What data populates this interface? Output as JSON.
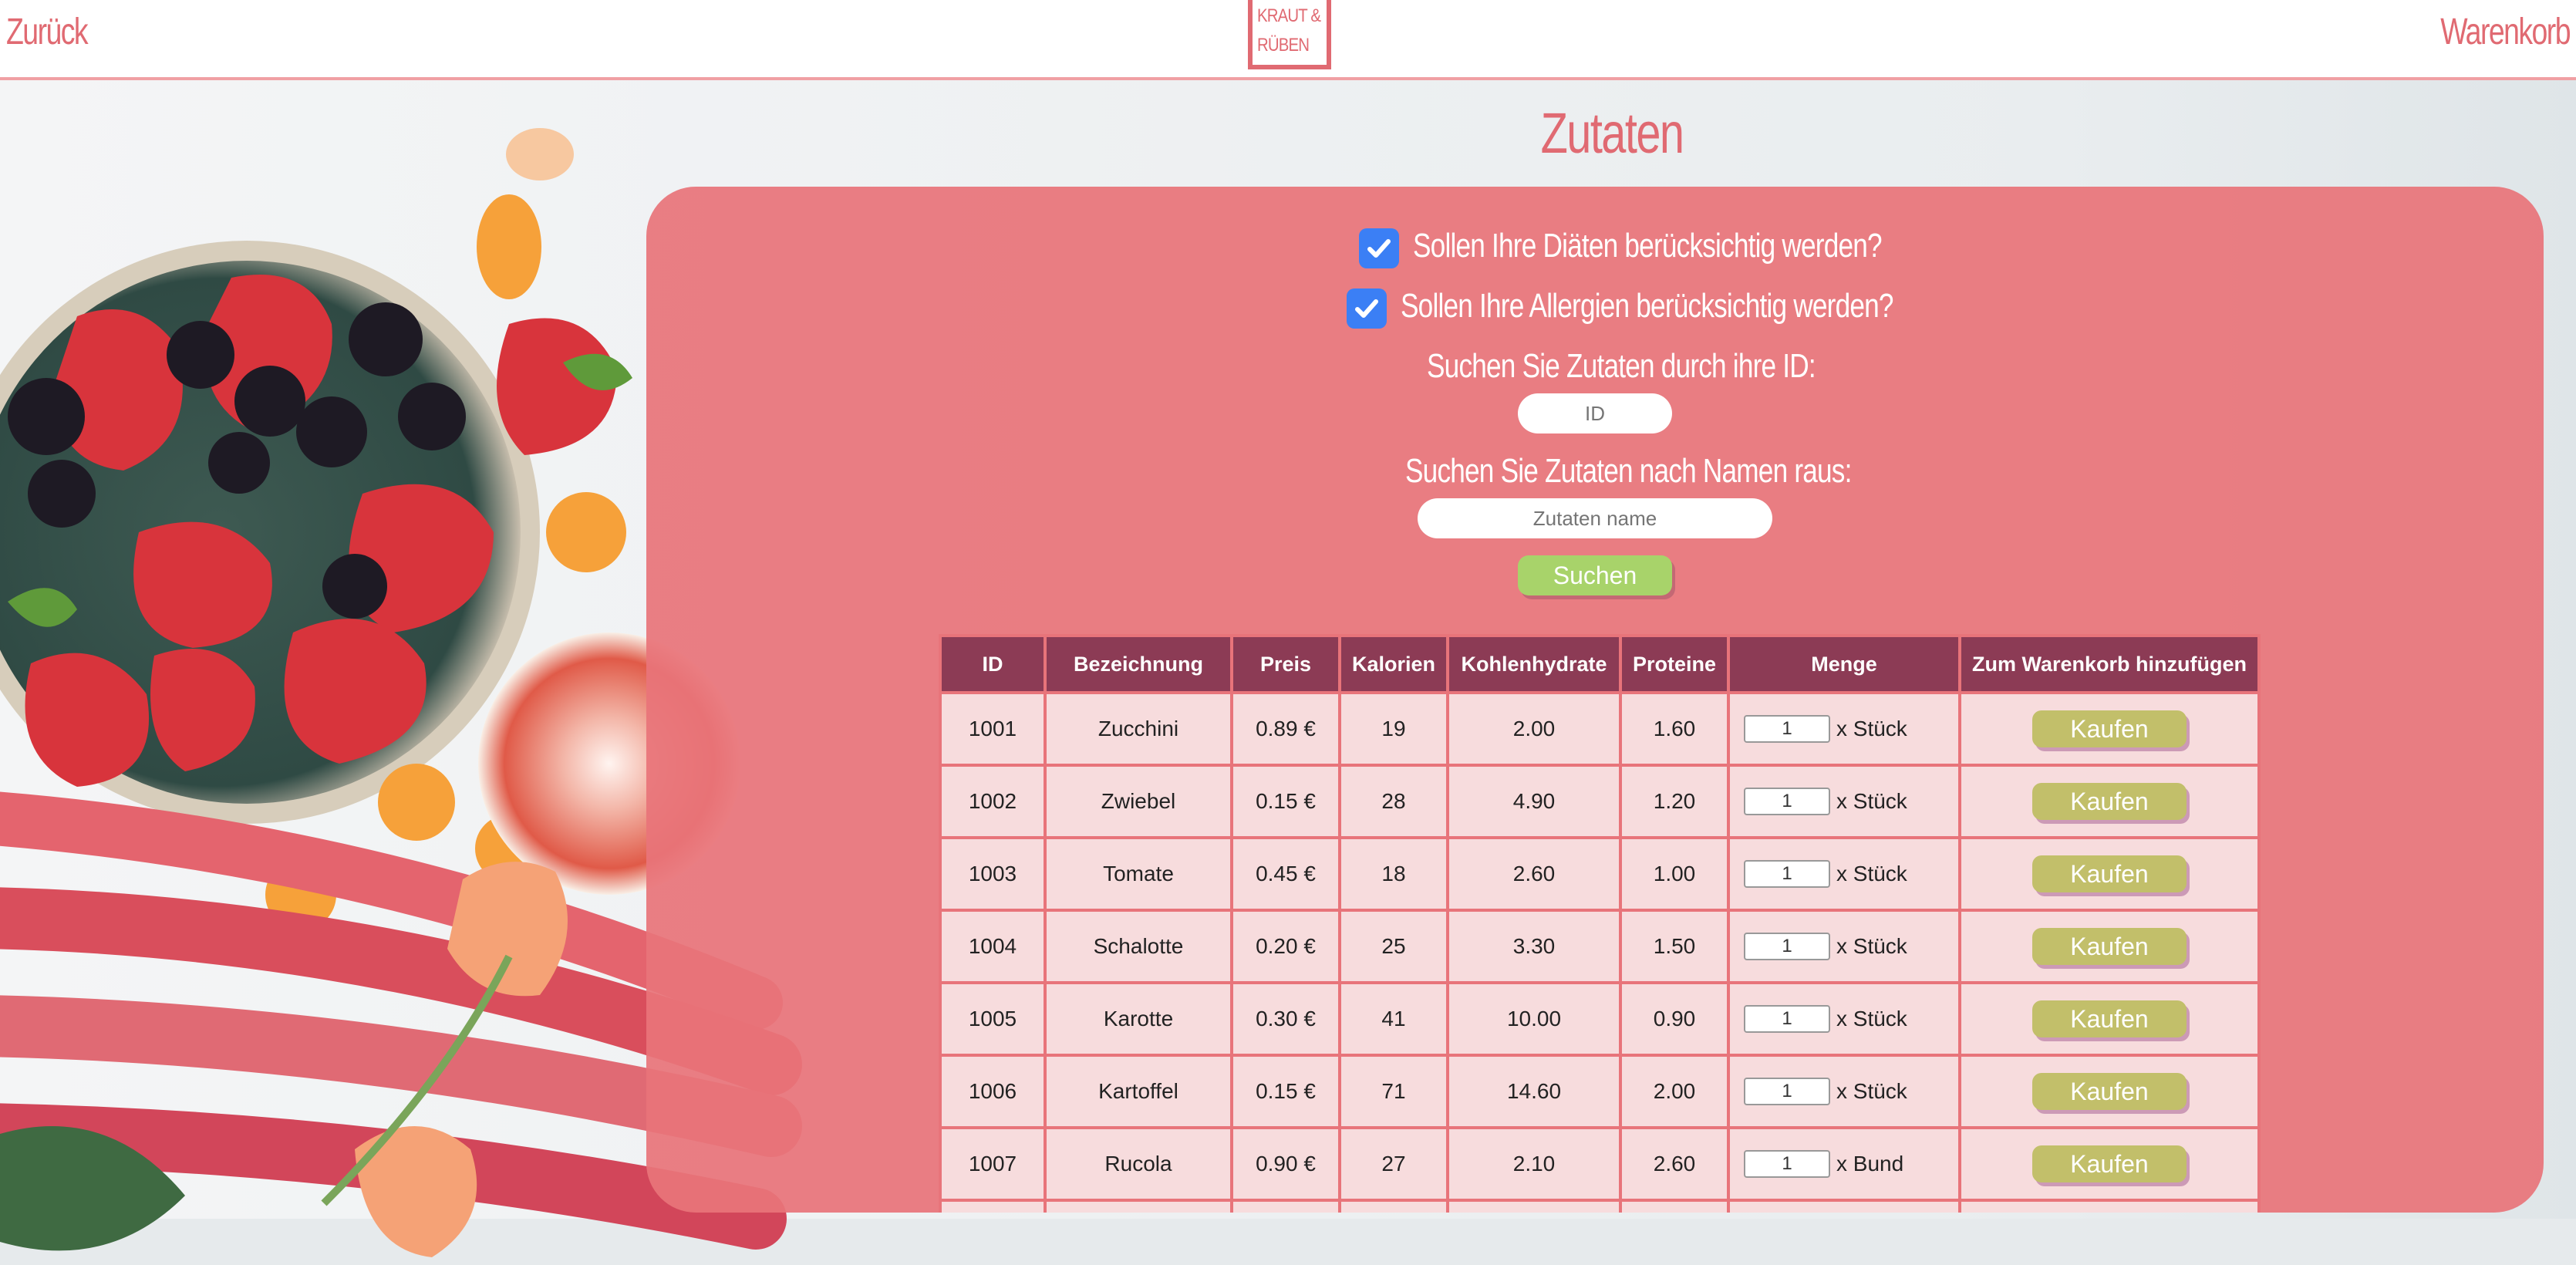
{
  "header": {
    "back_label": "Zurück",
    "cart_label": "Warenkorb",
    "logo_line1": "KRAUT &",
    "logo_line2": "RÜBEN"
  },
  "page_title": "Zutaten",
  "filters": {
    "diets_label": "Sollen Ihre Diäten berücksichtig werden?",
    "diets_checked": true,
    "allergies_label": "Sollen Ihre Allergien berücksichtig werden?",
    "allergies_checked": true,
    "id_search_label": "Suchen Sie Zutaten durch ihre ID:",
    "id_placeholder": "ID",
    "name_search_label": "Suchen Sie Zutaten nach Namen raus:",
    "name_placeholder": "Zutaten name",
    "search_button": "Suchen"
  },
  "table": {
    "columns": [
      "ID",
      "Bezeichnung",
      "Preis",
      "Kalorien",
      "Kohlenhydrate",
      "Proteine",
      "Menge",
      "Zum Warenkorb hinzufügen"
    ],
    "rows": [
      {
        "id": "1001",
        "name": "Zucchini",
        "price": "0.89 €",
        "kcal": "19",
        "carbs": "2.00",
        "protein": "1.60",
        "qty": "1",
        "unit": "x Stück",
        "buy": "Kaufen"
      },
      {
        "id": "1002",
        "name": "Zwiebel",
        "price": "0.15 €",
        "kcal": "28",
        "carbs": "4.90",
        "protein": "1.20",
        "qty": "1",
        "unit": "x Stück",
        "buy": "Kaufen"
      },
      {
        "id": "1003",
        "name": "Tomate",
        "price": "0.45 €",
        "kcal": "18",
        "carbs": "2.60",
        "protein": "1.00",
        "qty": "1",
        "unit": "x Stück",
        "buy": "Kaufen"
      },
      {
        "id": "1004",
        "name": "Schalotte",
        "price": "0.20 €",
        "kcal": "25",
        "carbs": "3.30",
        "protein": "1.50",
        "qty": "1",
        "unit": "x Stück",
        "buy": "Kaufen"
      },
      {
        "id": "1005",
        "name": "Karotte",
        "price": "0.30 €",
        "kcal": "41",
        "carbs": "10.00",
        "protein": "0.90",
        "qty": "1",
        "unit": "x Stück",
        "buy": "Kaufen"
      },
      {
        "id": "1006",
        "name": "Kartoffel",
        "price": "0.15 €",
        "kcal": "71",
        "carbs": "14.60",
        "protein": "2.00",
        "qty": "1",
        "unit": "x Stück",
        "buy": "Kaufen"
      },
      {
        "id": "1007",
        "name": "Rucola",
        "price": "0.90 €",
        "kcal": "27",
        "carbs": "2.10",
        "protein": "2.60",
        "qty": "1",
        "unit": "x Bund",
        "buy": "Kaufen"
      }
    ]
  },
  "colors": {
    "accent": "#e06a72",
    "panel": "#e8747a",
    "table_header": "#8c3b55",
    "table_cell": "#f7dcdd",
    "search_button": "#a8d36a",
    "buy_button": "#c2bf6a",
    "checkbox": "#3b7ff5"
  }
}
